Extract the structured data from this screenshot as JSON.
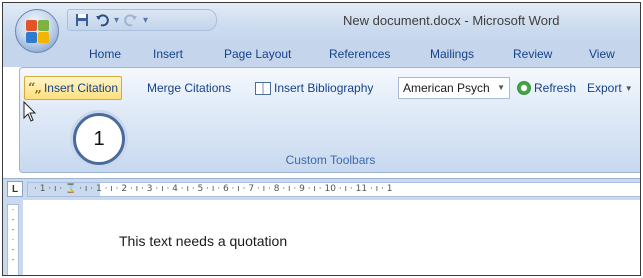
{
  "window": {
    "title": "New document.docx - Microsoft Word"
  },
  "quick_access": {
    "save_icon": "save-icon",
    "undo_icon": "undo-icon",
    "redo_icon": "redo-icon",
    "more_icon": "customize-icon"
  },
  "tabs": [
    {
      "label": "Home"
    },
    {
      "label": "Insert"
    },
    {
      "label": "Page Layout"
    },
    {
      "label": "References"
    },
    {
      "label": "Mailings"
    },
    {
      "label": "Review"
    },
    {
      "label": "View"
    }
  ],
  "ribbon": {
    "insert_citation": "Insert Citation",
    "quote_glyph": "“„",
    "merge_citations": "Merge Citations",
    "insert_bibliography": "Insert Bibliography",
    "style_value": "American Psych",
    "refresh": "Refresh",
    "export": "Export",
    "group_label": "Custom Toolbars"
  },
  "callout": {
    "number": "1"
  },
  "ruler": {
    "tab_selector": "L",
    "scale": "· 1 · ı · ⌛ · ı · 1 · ı · 2 · ı · 3 · ı · 4 · ı · 5 · ı · 6 · ı · 7 · ı · 8 · ı · 9 · ı · 10 · ı · 11 · ı · 1"
  },
  "document": {
    "text": "This text needs a quotation"
  },
  "colors": {
    "accent": "#15428b",
    "ribbon_bg": "#d3e1f3",
    "active_button": "#ffdf7d"
  }
}
